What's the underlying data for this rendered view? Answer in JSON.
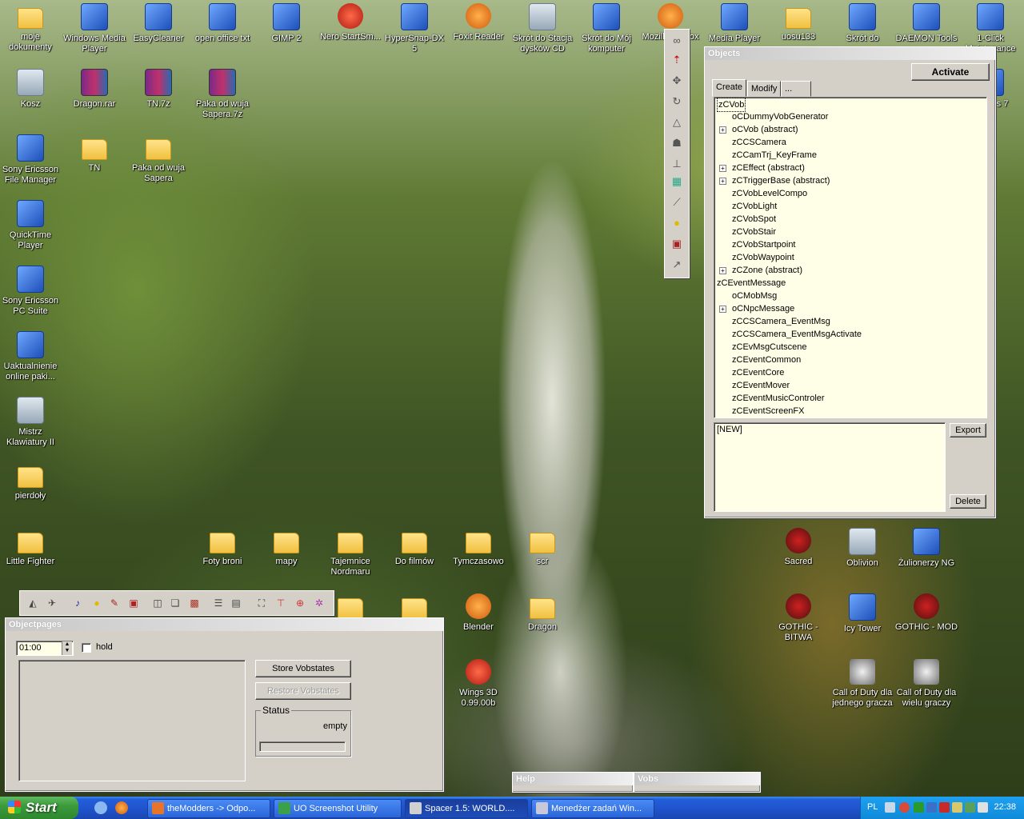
{
  "desktop": {
    "icons": [
      {
        "label": "moje dokumenty",
        "kind": "folder",
        "icon": "my-documents-icon"
      },
      {
        "label": "Windows Media Player",
        "kind": "app",
        "icon": "media-player-icon"
      },
      {
        "label": "EasyCleaner",
        "kind": "app",
        "icon": "easycleaner-icon"
      },
      {
        "label": "open office txt",
        "kind": "app",
        "icon": "document-icon"
      },
      {
        "label": "GIMP 2",
        "kind": "app",
        "icon": "gimp-icon"
      },
      {
        "label": "Nero StartSm...",
        "kind": "red",
        "icon": "nero-icon"
      },
      {
        "label": "HyperSnap-DX 5",
        "kind": "app",
        "icon": "camera-icon"
      },
      {
        "label": "Foxit Reader",
        "kind": "orange",
        "icon": "foxit-icon"
      },
      {
        "label": "Skrót do Stacja dysków CD",
        "kind": "bin",
        "icon": "cd-drive-icon"
      },
      {
        "label": "Skrót do Mój komputer",
        "kind": "app",
        "icon": "computer-icon"
      },
      {
        "label": "Mozilla Firefox",
        "kind": "orange",
        "icon": "firefox-icon"
      },
      {
        "label": "Media Player",
        "kind": "app",
        "icon": "clapper-icon"
      },
      {
        "label": "uosu133",
        "kind": "folder",
        "icon": "folder-icon"
      },
      {
        "label": "Skrót do",
        "kind": "app",
        "icon": "landscape-icon"
      },
      {
        "label": "DAEMON Tools",
        "kind": "app",
        "icon": "daemon-tools-icon"
      },
      {
        "label": "1-Click Maintenance",
        "kind": "app",
        "icon": "maintenance-icon"
      },
      {
        "label": "Kosz",
        "kind": "bin",
        "icon": "recycle-bin-icon"
      },
      {
        "label": "Dragon.rar",
        "kind": "rar",
        "icon": "winrar-icon"
      },
      {
        "label": "TN.7z",
        "kind": "rar",
        "icon": "winrar-icon"
      },
      {
        "label": "Paka od wuja Sapera.7z",
        "kind": "rar",
        "icon": "winrar-icon"
      },
      {
        "label": "Utilities 7",
        "kind": "app",
        "icon": "utilities-icon"
      },
      {
        "label": "Sony Ericsson File Manager",
        "kind": "app",
        "icon": "phone-icon"
      },
      {
        "label": "TN",
        "kind": "folder",
        "icon": "folder-icon"
      },
      {
        "label": "Paka od wuja Sapera",
        "kind": "folder",
        "icon": "folder-icon"
      },
      {
        "label": "QuickTime Player",
        "kind": "app",
        "icon": "quicktime-icon"
      },
      {
        "label": "Sony Ericsson PC Suite",
        "kind": "app",
        "icon": "pc-suite-icon"
      },
      {
        "label": "Uaktualnienie online paki...",
        "kind": "app",
        "icon": "update-icon"
      },
      {
        "label": "Mistrz Klawiatury II",
        "kind": "bin",
        "icon": "keyboard-icon"
      },
      {
        "label": "pierdoły",
        "kind": "folder",
        "icon": "folder-icon"
      },
      {
        "label": "Little Fighter",
        "kind": "folder",
        "icon": "folder-icon"
      },
      {
        "label": "Foty broni",
        "kind": "folder",
        "icon": "folder-icon"
      },
      {
        "label": "mapy",
        "kind": "folder",
        "icon": "folder-icon"
      },
      {
        "label": "Tajemnice Nordmaru",
        "kind": "folder",
        "icon": "folder-icon"
      },
      {
        "label": "Do filmów",
        "kind": "folder",
        "icon": "folder-icon"
      },
      {
        "label": "Tymczasowo",
        "kind": "folder",
        "icon": "folder-icon"
      },
      {
        "label": "scr",
        "kind": "folder",
        "icon": "folder-icon"
      },
      {
        "label": "Sacred",
        "kind": "gothic",
        "icon": "sacred-icon"
      },
      {
        "label": "Oblivion",
        "kind": "bin",
        "icon": "oblivion-icon"
      },
      {
        "label": "Żulionerzy NG",
        "kind": "app",
        "icon": "game-icon"
      },
      {
        "label": "",
        "kind": "folder",
        "icon": "folder-icon"
      },
      {
        "label": "",
        "kind": "folder",
        "icon": "folder-icon"
      },
      {
        "label": "Blender",
        "kind": "orange",
        "icon": "blender-icon"
      },
      {
        "label": "Dragon",
        "kind": "folder",
        "icon": "folder-icon"
      },
      {
        "label": "GOTHIC - BITWA",
        "kind": "gothic",
        "icon": "gothic-icon"
      },
      {
        "label": "Icy Tower",
        "kind": "app",
        "icon": "icy-tower-icon"
      },
      {
        "label": "GOTHIC - MOD",
        "kind": "gothic",
        "icon": "gothic-icon"
      },
      {
        "label": "Wings 3D 0.99.00b",
        "kind": "red",
        "icon": "wings3d-icon"
      },
      {
        "label": "Call of Duty dla jednego gracza",
        "kind": "star",
        "icon": "cod-icon"
      },
      {
        "label": "Call of Duty dla wielu graczy",
        "kind": "star",
        "icon": "cod-icon"
      }
    ]
  },
  "objects_window": {
    "title": "Objects",
    "activate_label": "Activate",
    "tabs": [
      "Create",
      "Modify",
      "..."
    ],
    "tree": [
      {
        "label": "zCVob",
        "level": 0,
        "expander": false
      },
      {
        "label": "oCDummyVobGenerator",
        "level": 1,
        "expander": false
      },
      {
        "label": "oCVob (abstract)",
        "level": 1,
        "expander": true
      },
      {
        "label": "zCCSCamera",
        "level": 1,
        "expander": false
      },
      {
        "label": "zCCamTrj_KeyFrame",
        "level": 1,
        "expander": false
      },
      {
        "label": "zCEffect (abstract)",
        "level": 1,
        "expander": true
      },
      {
        "label": "zCTriggerBase (abstract)",
        "level": 1,
        "expander": true
      },
      {
        "label": "zCVobLevelCompo",
        "level": 1,
        "expander": false
      },
      {
        "label": "zCVobLight",
        "level": 1,
        "expander": false
      },
      {
        "label": "zCVobSpot",
        "level": 1,
        "expander": false
      },
      {
        "label": "zCVobStair",
        "level": 1,
        "expander": false
      },
      {
        "label": "zCVobStartpoint",
        "level": 1,
        "expander": false
      },
      {
        "label": "zCVobWaypoint",
        "level": 1,
        "expander": false
      },
      {
        "label": "zCZone (abstract)",
        "level": 1,
        "expander": true
      },
      {
        "label": "zCEventMessage",
        "level": 0,
        "expander": false
      },
      {
        "label": "oCMobMsg",
        "level": 1,
        "expander": false
      },
      {
        "label": "oCNpcMessage",
        "level": 1,
        "expander": true
      },
      {
        "label": "zCCSCamera_EventMsg",
        "level": 1,
        "expander": false
      },
      {
        "label": "zCCSCamera_EventMsgActivate",
        "level": 1,
        "expander": false
      },
      {
        "label": "zCEvMsgCutscene",
        "level": 1,
        "expander": false
      },
      {
        "label": "zCEventCommon",
        "level": 1,
        "expander": false
      },
      {
        "label": "zCEventCore",
        "level": 1,
        "expander": false
      },
      {
        "label": "zCEventMover",
        "level": 1,
        "expander": false
      },
      {
        "label": "zCEventMusicControler",
        "level": 1,
        "expander": false
      },
      {
        "label": "zCEventScreenFX",
        "level": 1,
        "expander": false
      }
    ],
    "preset_text": "[NEW]",
    "export_label": "Export",
    "delete_label": "Delete"
  },
  "objectpages_window": {
    "title": "Objectpages",
    "time_value": "01:00",
    "hold_label": "hold",
    "store_label": "Store Vobstates",
    "restore_label": "Restore Vobstates",
    "status_label": "Status",
    "status_value": "empty"
  },
  "docked_tabs": {
    "help": "Help",
    "vobs": "Vobs"
  },
  "taskbar": {
    "start_label": "Start",
    "tasks": [
      {
        "label": "theModders -> Odpo...",
        "icon": "firefox-icon",
        "active": false
      },
      {
        "label": "UO Screenshot Utility",
        "icon": "screenshot-icon",
        "active": false
      },
      {
        "label": "Spacer 1.5: WORLD....",
        "icon": "spacer-icon",
        "active": true
      },
      {
        "label": "Menedżer zadań Win...",
        "icon": "task-manager-icon",
        "active": false
      }
    ],
    "language": "PL",
    "clock": "22:38"
  }
}
